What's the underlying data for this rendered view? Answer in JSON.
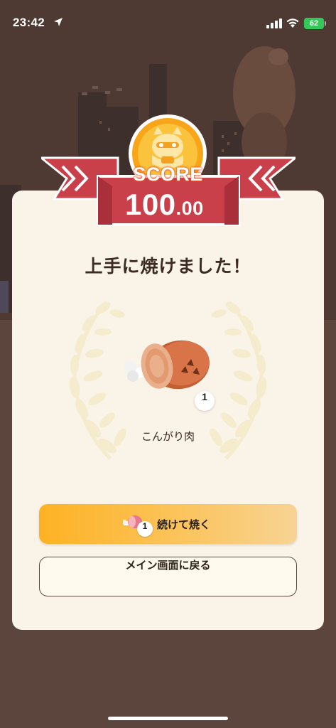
{
  "status_bar": {
    "time": "23:42",
    "battery": "62",
    "icons": [
      "location-arrow-icon",
      "cellular-signal-icon",
      "wifi-icon",
      "battery-icon"
    ]
  },
  "score": {
    "label": "SCORE",
    "integer": "100",
    "decimal": ".00"
  },
  "result": {
    "title": "上手に焼けました！",
    "item_name": "こんがり肉",
    "item_count": "1"
  },
  "buttons": {
    "continue_count": "1",
    "continue_label": "続けて焼く",
    "home_label": "メイン画面に戻る"
  },
  "colors": {
    "background": "#5c453d",
    "card": "#faf3e8",
    "ribbon": "#c9404a",
    "medal": "#f9a51a",
    "continue_button": "#fdb223",
    "title_text": "#3c2b22"
  }
}
